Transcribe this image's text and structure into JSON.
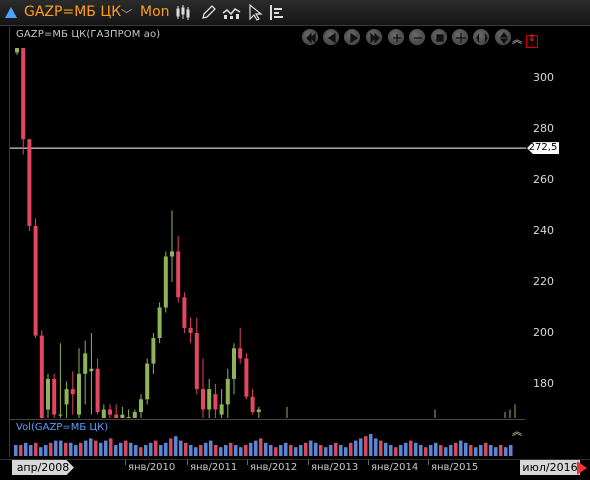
{
  "toolbar": {
    "symbol": "GAZP=МБ ЦК",
    "period": "Mon",
    "buttons": [
      "candlestick-icon",
      "pencil-icon",
      "compare-icon",
      "pointer-icon",
      "studies-icon"
    ]
  },
  "chart": {
    "title": "GAZP=МБ ЦК(ГАЗПРОМ ао)",
    "volume_title": "Vol(GAZP=МБ ЦК)",
    "current_price_label": "272,5",
    "y_ticks": [
      "300",
      "280",
      "260",
      "240",
      "220",
      "200",
      "180"
    ],
    "x_start_label": "апр/2008",
    "x_end_label": "июл/2016",
    "x_labels": [
      "янв/2010",
      "янв/2011",
      "янв/2012",
      "янв/2013",
      "янв/2014",
      "янв/2015"
    ],
    "nav_buttons": [
      "rewind-icon",
      "back-icon",
      "play-icon",
      "fast-forward-icon",
      "zoom-in-icon",
      "zoom-out-icon",
      "zoom-fit-icon",
      "pan-icon",
      "scroll-icon",
      "reset-icon"
    ],
    "colors": {
      "up": "#8fb35a",
      "down": "#e2475f",
      "volume_up": "#5b86d6",
      "volume_down": "#d24b60",
      "price_line": "#ffffff"
    }
  },
  "chart_data": {
    "type": "candlestick",
    "y_range": [
      166,
      326
    ],
    "current_price": 272.5,
    "x_range": [
      "2008-04",
      "2016-07"
    ],
    "candles": [
      {
        "o": 310,
        "h": 326,
        "l": 309,
        "c": 324
      },
      {
        "o": 327,
        "h": 327,
        "l": 270,
        "c": 276
      },
      {
        "o": 276,
        "h": 276,
        "l": 240,
        "c": 242
      },
      {
        "o": 242,
        "h": 245,
        "l": 198,
        "c": 199
      },
      {
        "o": 199,
        "h": 201,
        "l": 166,
        "c": 166
      },
      {
        "o": 170,
        "h": 184,
        "l": 166,
        "c": 182
      },
      {
        "o": 182,
        "h": 184,
        "l": 166,
        "c": 168
      },
      {
        "o": 168,
        "h": 196,
        "l": 166,
        "c": 168
      },
      {
        "o": 172,
        "h": 181,
        "l": 166,
        "c": 178
      },
      {
        "o": 178,
        "h": 185,
        "l": 168,
        "c": 176
      },
      {
        "o": 168,
        "h": 194,
        "l": 166,
        "c": 184
      },
      {
        "o": 184,
        "h": 197,
        "l": 172,
        "c": 192
      },
      {
        "o": 185,
        "h": 200,
        "l": 168,
        "c": 186
      },
      {
        "o": 186,
        "h": 190,
        "l": 168,
        "c": 169
      },
      {
        "o": 166,
        "h": 172,
        "l": 166,
        "c": 170
      },
      {
        "o": 170,
        "h": 172,
        "l": 166,
        "c": 168
      },
      {
        "o": 168,
        "h": 172,
        "l": 166,
        "c": 166
      },
      {
        "o": 166,
        "h": 171,
        "l": 166,
        "c": 168
      },
      {
        "o": 166,
        "h": 170,
        "l": 166,
        "c": 167
      },
      {
        "o": 166,
        "h": 170,
        "l": 166,
        "c": 169
      },
      {
        "o": 169,
        "h": 176,
        "l": 166,
        "c": 174
      },
      {
        "o": 174,
        "h": 190,
        "l": 172,
        "c": 188
      },
      {
        "o": 188,
        "h": 200,
        "l": 184,
        "c": 198
      },
      {
        "o": 198,
        "h": 212,
        "l": 196,
        "c": 210
      },
      {
        "o": 210,
        "h": 232,
        "l": 208,
        "c": 230
      },
      {
        "o": 230,
        "h": 248,
        "l": 220,
        "c": 232
      },
      {
        "o": 232,
        "h": 238,
        "l": 212,
        "c": 214
      },
      {
        "o": 214,
        "h": 216,
        "l": 200,
        "c": 202
      },
      {
        "o": 202,
        "h": 206,
        "l": 196,
        "c": 200
      },
      {
        "o": 200,
        "h": 206,
        "l": 176,
        "c": 178
      },
      {
        "o": 178,
        "h": 190,
        "l": 166,
        "c": 170
      },
      {
        "o": 170,
        "h": 182,
        "l": 166,
        "c": 178
      },
      {
        "o": 176,
        "h": 180,
        "l": 166,
        "c": 170
      },
      {
        "o": 168,
        "h": 178,
        "l": 166,
        "c": 172
      },
      {
        "o": 172,
        "h": 186,
        "l": 166,
        "c": 182
      },
      {
        "o": 182,
        "h": 196,
        "l": 176,
        "c": 194
      },
      {
        "o": 194,
        "h": 202,
        "l": 188,
        "c": 190
      },
      {
        "o": 190,
        "h": 192,
        "l": 174,
        "c": 175
      },
      {
        "o": 175,
        "h": 178,
        "l": 168,
        "c": 169
      },
      {
        "o": 169,
        "h": 171,
        "l": 166,
        "c": 170
      }
    ],
    "tail_ticks": [
      {
        "h": 171,
        "l": 166
      },
      {
        "h": 170,
        "l": 166
      },
      {
        "h": 169,
        "l": 166
      },
      {
        "h": 170,
        "l": 166
      },
      {
        "h": 172,
        "l": 166
      }
    ],
    "volume": [
      5,
      5,
      6,
      5,
      6,
      4,
      5,
      6,
      7,
      7,
      6,
      6,
      5,
      6,
      7,
      8,
      7,
      6,
      7,
      8,
      5,
      6,
      7,
      6,
      5,
      4,
      5,
      6,
      7,
      5,
      6,
      8,
      9,
      7,
      6,
      5,
      4,
      5,
      6,
      7,
      5,
      4,
      5,
      6,
      5,
      4,
      5,
      6,
      7,
      8,
      6,
      5,
      4,
      5,
      6,
      5,
      4,
      5,
      6,
      7,
      6,
      5,
      4,
      5,
      6,
      5,
      4,
      6,
      7,
      8,
      9,
      10,
      8,
      7,
      6,
      5,
      4,
      5,
      6,
      7,
      6,
      5,
      4,
      5,
      6,
      5,
      4,
      5,
      6,
      7,
      6,
      5,
      4,
      5,
      6,
      5,
      4,
      5,
      4,
      5
    ]
  }
}
